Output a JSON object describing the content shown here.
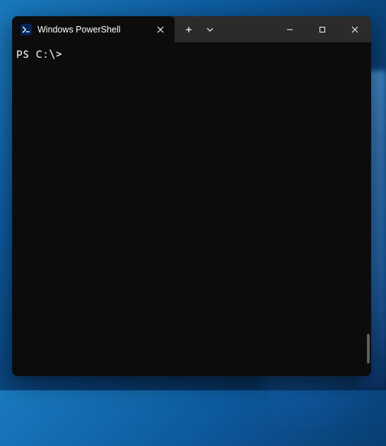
{
  "tab": {
    "title": "Windows PowerShell",
    "icon": "powershell-icon"
  },
  "terminal": {
    "prompt": "PS C:\\> "
  },
  "colors": {
    "tab_bg": "#0c0c0c",
    "titlebar_bg": "#2b2b2b",
    "terminal_bg": "#0c0c0c",
    "text": "#cccccc"
  }
}
